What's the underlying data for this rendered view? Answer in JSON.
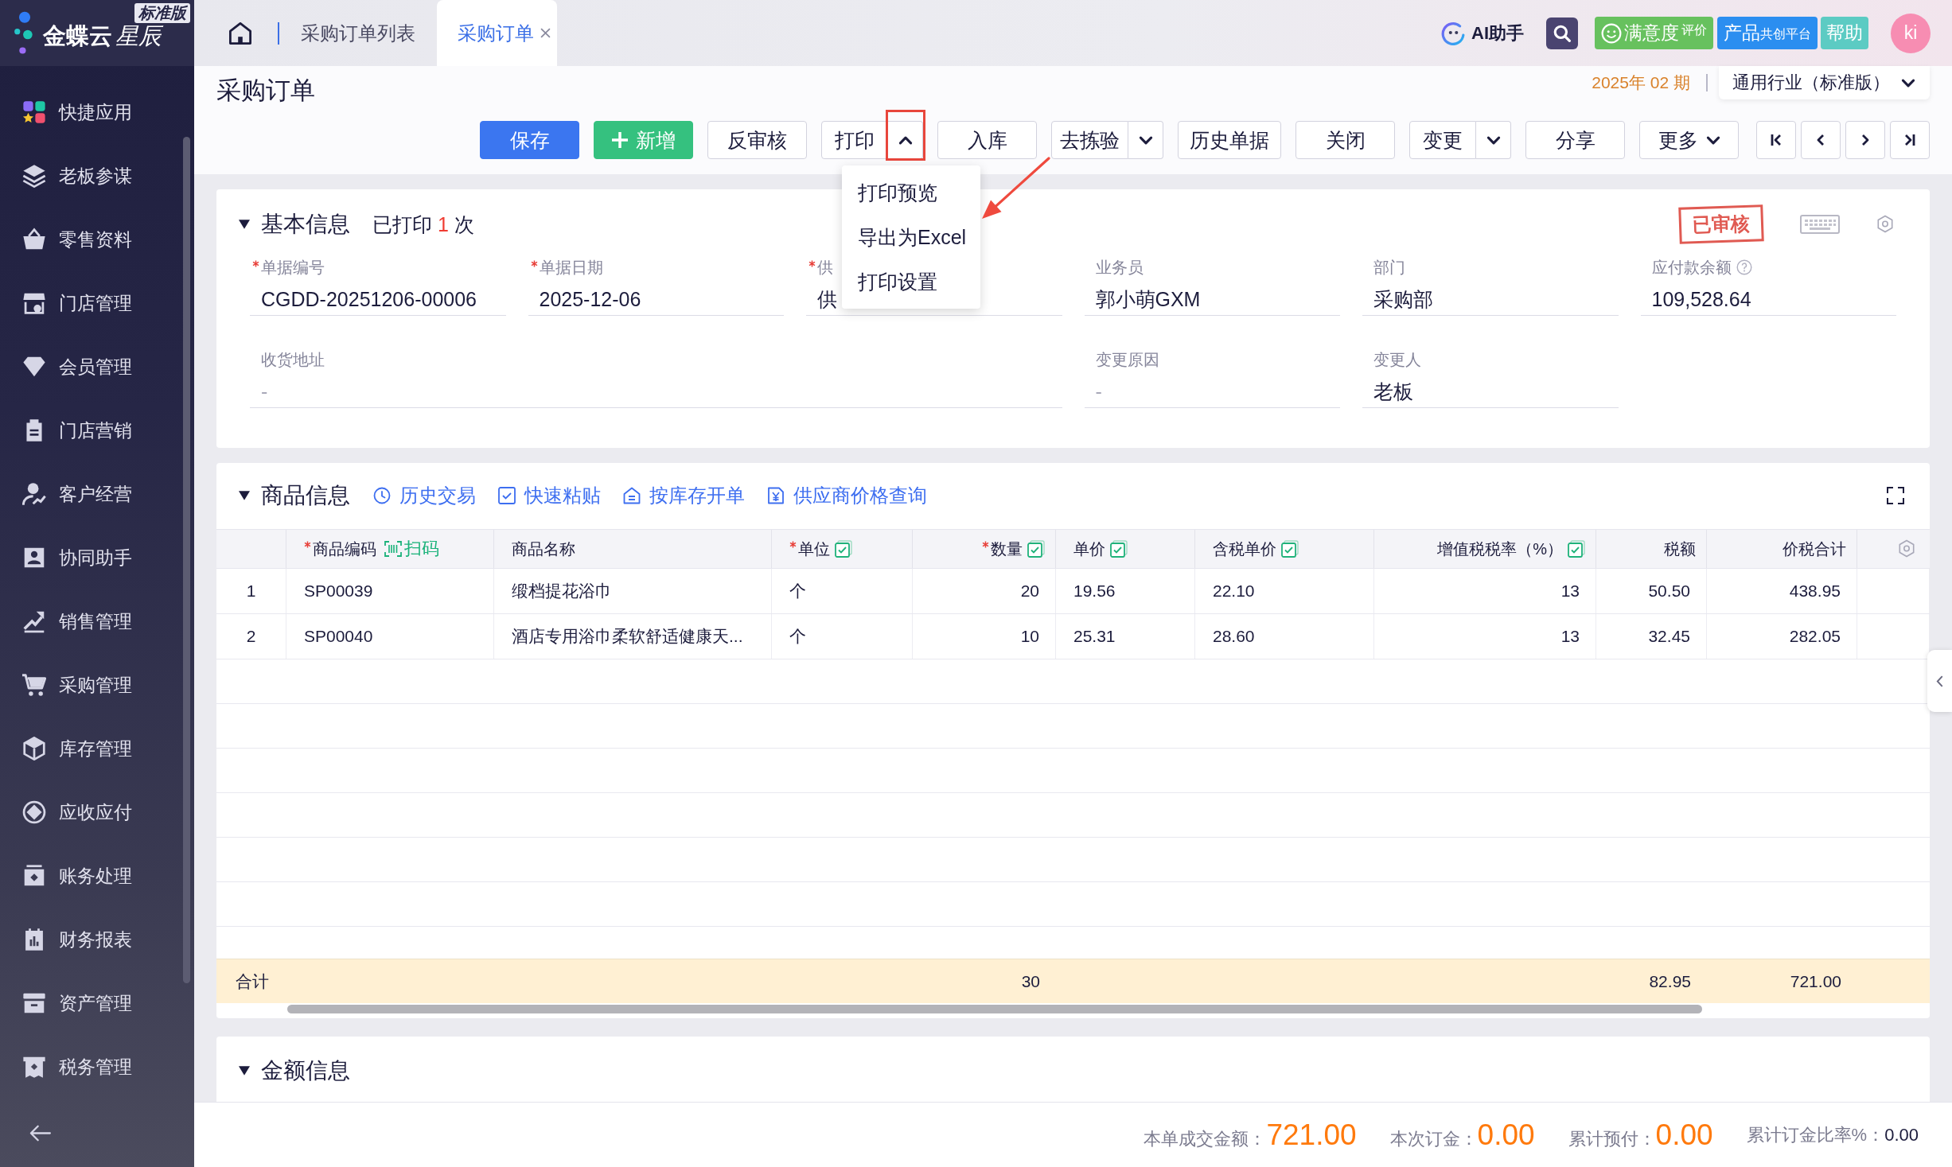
{
  "brand": {
    "name": "金蝶云",
    "name_styled": "星辰",
    "edition": "标准版"
  },
  "sidebar": {
    "items": [
      {
        "label": "快捷应用",
        "selected": false
      },
      {
        "label": "老板参谋",
        "selected": false
      },
      {
        "label": "零售资料",
        "selected": false
      },
      {
        "label": "门店管理",
        "selected": false
      },
      {
        "label": "会员管理",
        "selected": false
      },
      {
        "label": "门店营销",
        "selected": false
      },
      {
        "label": "客户经营",
        "selected": false
      },
      {
        "label": "协同助手",
        "selected": false
      },
      {
        "label": "销售管理",
        "selected": false
      },
      {
        "label": "采购管理",
        "selected": false
      },
      {
        "label": "库存管理",
        "selected": false
      },
      {
        "label": "应收应付",
        "selected": false
      },
      {
        "label": "账务处理",
        "selected": false
      },
      {
        "label": "财务报表",
        "selected": false
      },
      {
        "label": "资产管理",
        "selected": false
      },
      {
        "label": "税务管理",
        "selected": false
      }
    ]
  },
  "tabs": [
    {
      "label": "采购订单列表",
      "selected": false,
      "closable": false
    },
    {
      "label": "采购订单",
      "selected": true,
      "closable": true
    }
  ],
  "header_actions": {
    "ai_assistant": "AI助手",
    "satisfaction": {
      "label": "满意度",
      "tag": "评价"
    },
    "co_creation": {
      "label": "产品",
      "tag": "共创平台"
    },
    "help": "帮助",
    "avatar": "ki"
  },
  "page": {
    "title": "采购订单",
    "period": "2025年 02 期",
    "industry": "通用行业（标准版）"
  },
  "toolbar": {
    "buttons": [
      {
        "label": "保存",
        "kind": "primary"
      },
      {
        "label": "新增",
        "kind": "add"
      },
      {
        "label": "反审核",
        "kind": "plain"
      },
      {
        "label": "打印",
        "kind": "split",
        "menu_open": true,
        "highlighted": true,
        "menu": [
          "打印预览",
          "导出为Excel",
          "打印设置"
        ]
      },
      {
        "label": "入库",
        "kind": "plain"
      },
      {
        "label": "去拣验",
        "kind": "split",
        "menu_open": false,
        "highlighted": false
      },
      {
        "label": "历史单据",
        "kind": "plain"
      },
      {
        "label": "关闭",
        "kind": "plain"
      },
      {
        "label": "变更",
        "kind": "split",
        "menu_open": false,
        "highlighted": false
      },
      {
        "label": "分享",
        "kind": "plain"
      },
      {
        "label": "更多",
        "kind": "menu"
      }
    ]
  },
  "basic_info": {
    "title": "基本信息",
    "expanded": true,
    "print_info": {
      "prefix": "已打印",
      "count": "1",
      "suffix": "次"
    },
    "stamp": "已审核",
    "fields": [
      {
        "kind": "line",
        "label": "单据编号",
        "required": true,
        "help": false,
        "value": "CGDD-20251206-00006"
      },
      {
        "kind": "line",
        "label": "单据日期",
        "required": true,
        "help": false,
        "value": "2025-12-06"
      },
      {
        "kind": "line",
        "label": "供",
        "required": true,
        "help": false,
        "value": "供"
      },
      {
        "kind": "line",
        "label": "业务员",
        "required": false,
        "help": false,
        "value": "郭小萌GXM"
      },
      {
        "kind": "line",
        "label": "部门",
        "required": false,
        "help": false,
        "value": "采购部"
      },
      {
        "kind": "line",
        "label": "应付款余额",
        "required": false,
        "help": true,
        "value": "109,528.64"
      },
      {
        "kind": "wide",
        "label": "收货地址",
        "required": false,
        "help": false,
        "placeholder": "-"
      },
      {
        "kind": "line",
        "label": "变更原因",
        "required": false,
        "help": false,
        "placeholder": "-"
      },
      {
        "kind": "line",
        "label": "变更人",
        "required": false,
        "help": false,
        "value": "老板"
      }
    ]
  },
  "products": {
    "title": "商品信息",
    "expanded": true,
    "actions": [
      "历史交易",
      "快速粘贴",
      "按库存开单",
      "供应商价格查询"
    ],
    "columns": [
      {
        "label": "商品编码",
        "required": true,
        "toggle": false,
        "scan": "扫码"
      },
      {
        "label": "商品名称",
        "required": false,
        "toggle": false
      },
      {
        "label": "单位",
        "required": true,
        "toggle": true
      },
      {
        "label": "数量",
        "required": true,
        "toggle": true
      },
      {
        "label": "单价",
        "required": false,
        "toggle": true
      },
      {
        "label": "含税单价",
        "required": false,
        "toggle": true
      },
      {
        "label": "增值税税率（%）",
        "required": false,
        "toggle": true
      },
      {
        "label": "税额",
        "required": false,
        "toggle": false
      },
      {
        "label": "价税合计",
        "required": false,
        "toggle": false
      }
    ],
    "rows": [
      {
        "index": "1",
        "cells": [
          "SP00039",
          "缎档提花浴巾",
          "个",
          "20",
          "19.56",
          "22.10",
          "13",
          "50.50",
          "438.95"
        ]
      },
      {
        "index": "2",
        "cells": [
          "SP00040",
          "酒店专用浴巾柔软舒适健康天...",
          "个",
          "10",
          "25.31",
          "28.60",
          "13",
          "32.45",
          "282.05"
        ]
      }
    ],
    "total": {
      "label": "合计",
      "quantity": "30",
      "tax": "82.95",
      "amount": "721.00"
    }
  },
  "amount_info": {
    "title": "金额信息",
    "expanded": true
  },
  "summary": [
    {
      "label": "本单成交金额：",
      "value": "721.00",
      "kind": "amount"
    },
    {
      "label": "本次订金：",
      "value": "0.00",
      "kind": "amount"
    },
    {
      "label": "累计预付：",
      "value": "0.00",
      "kind": "amount"
    },
    {
      "label": "累计订金比率%：",
      "value": "0.00",
      "kind": "plain"
    }
  ]
}
